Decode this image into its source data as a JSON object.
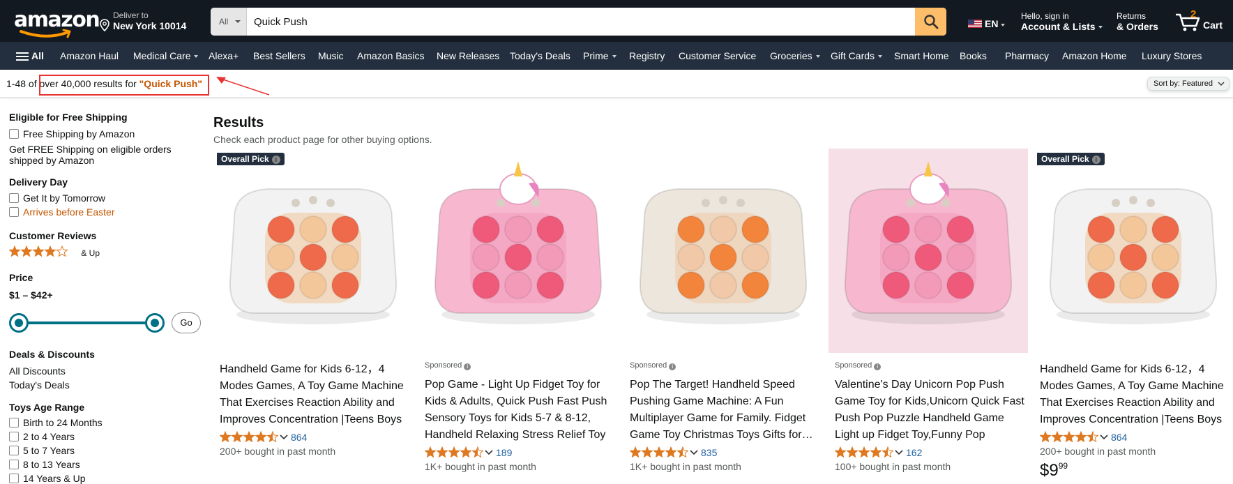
{
  "header": {
    "logo": "amazon",
    "deliver_line1": "Deliver to",
    "deliver_line2": "New York 10014",
    "search_category": "All",
    "search_value": "Quick Push",
    "language": "EN",
    "account_line1": "Hello, sign in",
    "account_line2": "Account & Lists",
    "returns_line1": "Returns",
    "returns_line2": "& Orders",
    "cart_count": "2",
    "cart_label": "Cart",
    "icons": [
      "location-pin-icon",
      "search-icon",
      "us-flag-icon",
      "cart-icon"
    ]
  },
  "nav": {
    "all_label": "All",
    "items": [
      {
        "label": "Amazon Haul"
      },
      {
        "label": "Medical Care"
      },
      {
        "label": "Alexa+"
      },
      {
        "label": "Best Sellers"
      },
      {
        "label": "Music"
      },
      {
        "label": "Amazon Basics"
      },
      {
        "label": "New Releases"
      },
      {
        "label": "Today's Deals"
      },
      {
        "label": "Prime"
      },
      {
        "label": "Registry"
      },
      {
        "label": "Customer Service"
      },
      {
        "label": "Groceries"
      },
      {
        "label": "Gift Cards"
      },
      {
        "label": "Smart Home"
      },
      {
        "label": "Books"
      },
      {
        "label": "Pharmacy"
      },
      {
        "label": "Amazon Home"
      },
      {
        "label": "Luxury Stores"
      }
    ]
  },
  "resultbar": {
    "count_prefix": "1-48 of over 40,000 results for ",
    "query": "\"Quick Push\"",
    "sort_label": "Sort by:",
    "sort_value": "Featured"
  },
  "filters": {
    "free_shipping_title": "Eligible for Free Shipping",
    "free_shipping_option": "Free Shipping by Amazon",
    "free_shipping_note_1": "Get FREE Shipping on eligible orders",
    "free_shipping_note_2": "shipped by Amazon",
    "delivery_title": "Delivery Day",
    "delivery_opt1": "Get It by Tomorrow",
    "delivery_opt2": "Arrives before Easter",
    "reviews_title": "Customer Reviews",
    "reviews_stars": 4,
    "reviews_suffix": "& Up",
    "price_title": "Price",
    "price_range": "$1 – $42+",
    "price_slider_min_fraction": 0,
    "price_slider_max_fraction": 1,
    "go_label": "Go",
    "deals_title": "Deals & Discounts",
    "deals_opt1": "All Discounts",
    "deals_opt2": "Today's Deals",
    "age_title": "Toys Age Range",
    "age_options": [
      "Birth to 24 Months",
      "2 to 4 Years",
      "5 to 7 Years",
      "8 to 13 Years",
      "14 Years & Up"
    ]
  },
  "results": {
    "title": "Results",
    "subtitle": "Check each product page for other buying options.",
    "products": [
      {
        "badge": "Overall Pick",
        "sponsored": "",
        "title": "Handheld Game for Kids 6-12，4 Modes Games, A Toy Game Machine That Exercises Reaction Ability and Improves Concentration |Teens Boys",
        "stars": 4.5,
        "reviews": "864",
        "bought": "200+ bought in past month",
        "price_whole": "",
        "price_fraction": ""
      },
      {
        "badge": "",
        "sponsored": "Sponsored",
        "title": "Pop Game - Light Up Fidget Toy for Kids & Adults, Quick Push Fast Push Sensory Toys for Kids 5-7 & 8-12, Handheld Relaxing Stress Relief Toy",
        "stars": 4.5,
        "reviews": "189",
        "bought": "1K+ bought in past month",
        "price_whole": "",
        "price_fraction": ""
      },
      {
        "badge": "",
        "sponsored": "Sponsored",
        "title": "Pop The Target! Handheld Speed Pushing Game Machine: A Fun Multiplayer Game for Family. Fidget Game Toy Christmas Toys Gifts for Kids",
        "stars": 4.5,
        "reviews": "835",
        "bought": "1K+ bought in past month",
        "price_whole": "",
        "price_fraction": ""
      },
      {
        "badge": "",
        "sponsored": "Sponsored",
        "title": "Valentine's Day Unicorn Pop Push Game Toy for Kids,Unicorn Quick Fast Push Pop Puzzle Handheld Game Light up Fidget Toy,Funny Pop",
        "stars": 4.5,
        "reviews": "162",
        "bought": "100+ bought in past month",
        "price_whole": "",
        "price_fraction": ""
      },
      {
        "badge": "Overall Pick",
        "sponsored": "",
        "title": "Handheld Game for Kids 6-12，4 Modes Games, A Toy Game Machine That Exercises Reaction Ability and Improves Concentration |Teens Boys",
        "stars": 4.5,
        "reviews": "864",
        "bought": "200+ bought in past month",
        "price_whole": "$9",
        "price_fraction": "99"
      }
    ]
  },
  "colors": {
    "header_bg": "#131921",
    "nav_bg": "#232f3e",
    "search_button": "#febd69",
    "accent_orange": "#c45500",
    "link_blue": "#2162a1",
    "star_fill": "#de7921",
    "annotation_red": "#e8322f"
  }
}
